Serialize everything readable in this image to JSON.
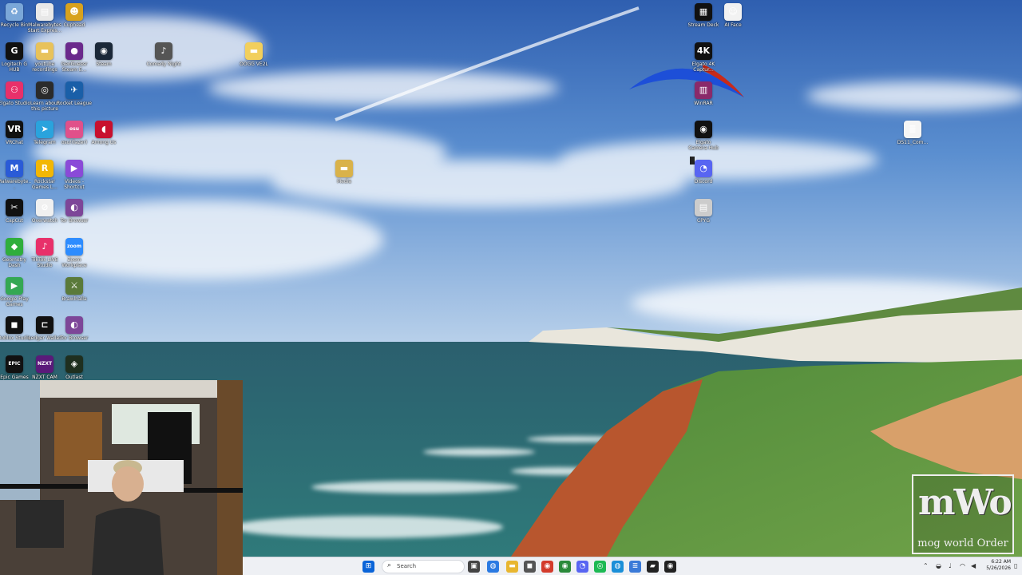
{
  "desktop": {
    "icons": [
      {
        "label": "Recycle Bin",
        "icon": "recycle-bin-icon",
        "color": "#7aa7d8",
        "glyph": "♻"
      },
      {
        "label": "Malwarebytes Start Expres...",
        "icon": "document-icon",
        "color": "#e8e8e8",
        "glyph": "▤"
      },
      {
        "label": "Cuphead",
        "icon": "cuphead-icon",
        "color": "#d8a21e",
        "glyph": "☻"
      },
      {
        "label": "Logitech G HUB",
        "icon": "logitech-g-icon",
        "color": "#111111",
        "glyph": "G"
      },
      {
        "label": "youtube recordings",
        "icon": "folder-icon",
        "color": "#e8c25a",
        "glyph": "▬"
      },
      {
        "label": "GeoGuessr Steam E...",
        "icon": "map-pin-icon",
        "color": "#6b2a8c",
        "glyph": "●"
      },
      {
        "label": "Steam",
        "icon": "steam-icon",
        "color": "#1b2838",
        "glyph": "◉"
      },
      {
        "label": "Comedy Night",
        "icon": "microphone-icon",
        "color": "#555555",
        "glyph": "♪"
      },
      {
        "label": "OOGG VE2L",
        "icon": "folder-icon",
        "color": "#f2cf5c",
        "glyph": "▬"
      },
      {
        "label": "Elgato Studio",
        "icon": "elgato-studio-icon",
        "color": "#e8306a",
        "glyph": "⚇"
      },
      {
        "label": "Learn about this picture",
        "icon": "camera-icon",
        "color": "#2b2b2b",
        "glyph": "◎"
      },
      {
        "label": "Rocket League",
        "icon": "rocket-league-icon",
        "color": "#1a5fa8",
        "glyph": "✈"
      },
      {
        "label": "VRChat",
        "icon": "vrchat-icon",
        "color": "#111111",
        "glyph": "VR"
      },
      {
        "label": "Telegram",
        "icon": "telegram-icon",
        "color": "#2aa3dd",
        "glyph": "➤"
      },
      {
        "label": "osu!(lazer)",
        "icon": "osu-icon",
        "color": "#e0508a",
        "glyph": "osu"
      },
      {
        "label": "Among Us",
        "icon": "among-us-icon",
        "color": "#c8102e",
        "glyph": "◖"
      },
      {
        "label": "Malwarebyte...",
        "icon": "malwarebytes-icon",
        "color": "#2a5bd7",
        "glyph": "M"
      },
      {
        "label": "Rockstar Games L...",
        "icon": "rockstar-icon",
        "color": "#f2b705",
        "glyph": "R"
      },
      {
        "label": "Videos - Shortcut",
        "icon": "video-icon",
        "color": "#8a4ad8",
        "glyph": "▶"
      },
      {
        "label": "CapCut",
        "icon": "capcut-icon",
        "color": "#111111",
        "glyph": "✂"
      },
      {
        "label": "Overwatch",
        "icon": "overwatch-icon",
        "color": "#f0f0f0",
        "glyph": "⊘"
      },
      {
        "label": "Tor Browser",
        "icon": "tor-browser-icon",
        "color": "#7d4698",
        "glyph": "◐"
      },
      {
        "label": "Geometry Dash",
        "icon": "geometry-dash-icon",
        "color": "#2fae3c",
        "glyph": "◆"
      },
      {
        "label": "TikTok LIVE Studio",
        "icon": "tiktok-icon",
        "color": "#e8306a",
        "glyph": "♪"
      },
      {
        "label": "Zoom Workplace",
        "icon": "zoom-icon",
        "color": "#2d8cff",
        "glyph": "zoom"
      },
      {
        "label": "Google Play Games",
        "icon": "google-play-icon",
        "color": "#34a853",
        "glyph": "▶"
      },
      {
        "label": "Brawlhalla",
        "icon": "brawlhalla-icon",
        "color": "#5a7a3a",
        "glyph": "⚔"
      },
      {
        "label": "Roblox Studio",
        "icon": "roblox-icon",
        "color": "#111111",
        "glyph": "◼"
      },
      {
        "label": "Ledger Wallet",
        "icon": "ledger-icon",
        "color": "#111111",
        "glyph": "⊏"
      },
      {
        "label": "Tor Browser",
        "icon": "tor-browser-icon",
        "color": "#7d4698",
        "glyph": "◐"
      },
      {
        "label": "Epic Games",
        "icon": "epic-games-icon",
        "color": "#111111",
        "glyph": "EPIC"
      },
      {
        "label": "NZXT CAM",
        "icon": "nzxt-icon",
        "color": "#5a1a7a",
        "glyph": "NZXT"
      },
      {
        "label": "Outlast",
        "icon": "outlast-icon",
        "color": "#1f2f1f",
        "glyph": "◈"
      },
      {
        "label": "Media",
        "icon": "folder-icon",
        "color": "#d9b24a",
        "glyph": "▬"
      },
      {
        "label": "Stream Deck",
        "icon": "stream-deck-icon",
        "color": "#111111",
        "glyph": "▦"
      },
      {
        "label": "AI Face",
        "icon": "ai-face-icon",
        "color": "#f2f2f2",
        "glyph": "☺"
      },
      {
        "label": "Elgato 4K Captur...",
        "icon": "elgato-4k-icon",
        "color": "#111111",
        "glyph": "4K"
      },
      {
        "label": "WinRAR",
        "icon": "winrar-icon",
        "color": "#8a2a6a",
        "glyph": "▥"
      },
      {
        "label": "Elgato Camera Hub",
        "icon": "elgato-camera-icon",
        "color": "#111111",
        "glyph": "◉"
      },
      {
        "label": "Discord",
        "icon": "discord-icon",
        "color": "#5865f2",
        "glyph": "◔"
      },
      {
        "label": "CPYG",
        "icon": "film-icon",
        "color": "#cccccc",
        "glyph": "▤"
      },
      {
        "label": "DS11_Com...",
        "icon": "document-icon",
        "color": "#f5f5f5",
        "glyph": "≣"
      }
    ]
  },
  "watermark": {
    "big": "mWo",
    "small": "mog world Order"
  },
  "taskbar": {
    "search_placeholder": "Search",
    "apps": [
      {
        "icon": "windows-start-icon",
        "color": "#0a64d8",
        "glyph": "⊞"
      },
      {
        "icon": "search-icon",
        "color": "#333333",
        "glyph": "⌕"
      },
      {
        "icon": "widgets-icon",
        "color": "#6a8a3a",
        "glyph": "☘"
      },
      {
        "icon": "task-view-icon",
        "color": "#444444",
        "glyph": "▣"
      },
      {
        "icon": "browser-icon",
        "color": "#2a7ae2",
        "glyph": "◍"
      },
      {
        "icon": "file-explorer-icon",
        "color": "#e8b630",
        "glyph": "▬"
      },
      {
        "icon": "store-icon",
        "color": "#555555",
        "glyph": "◼"
      },
      {
        "icon": "chrome-icon",
        "color": "#d33b2c",
        "glyph": "◉"
      },
      {
        "icon": "chrome-icon",
        "color": "#2a8a3a",
        "glyph": "◉"
      },
      {
        "icon": "discord-icon",
        "color": "#5865f2",
        "glyph": "◔"
      },
      {
        "icon": "spotify-icon",
        "color": "#1db954",
        "glyph": "◎"
      },
      {
        "icon": "edge-icon",
        "color": "#1a8fd8",
        "glyph": "◍"
      },
      {
        "icon": "notepad-icon",
        "color": "#3a7ad8",
        "glyph": "≣"
      },
      {
        "icon": "terminal-icon",
        "color": "#222222",
        "glyph": "▰"
      },
      {
        "icon": "obs-icon",
        "color": "#222222",
        "glyph": "◉"
      }
    ],
    "time": "6:22 AM",
    "date": "5/26/2026"
  }
}
